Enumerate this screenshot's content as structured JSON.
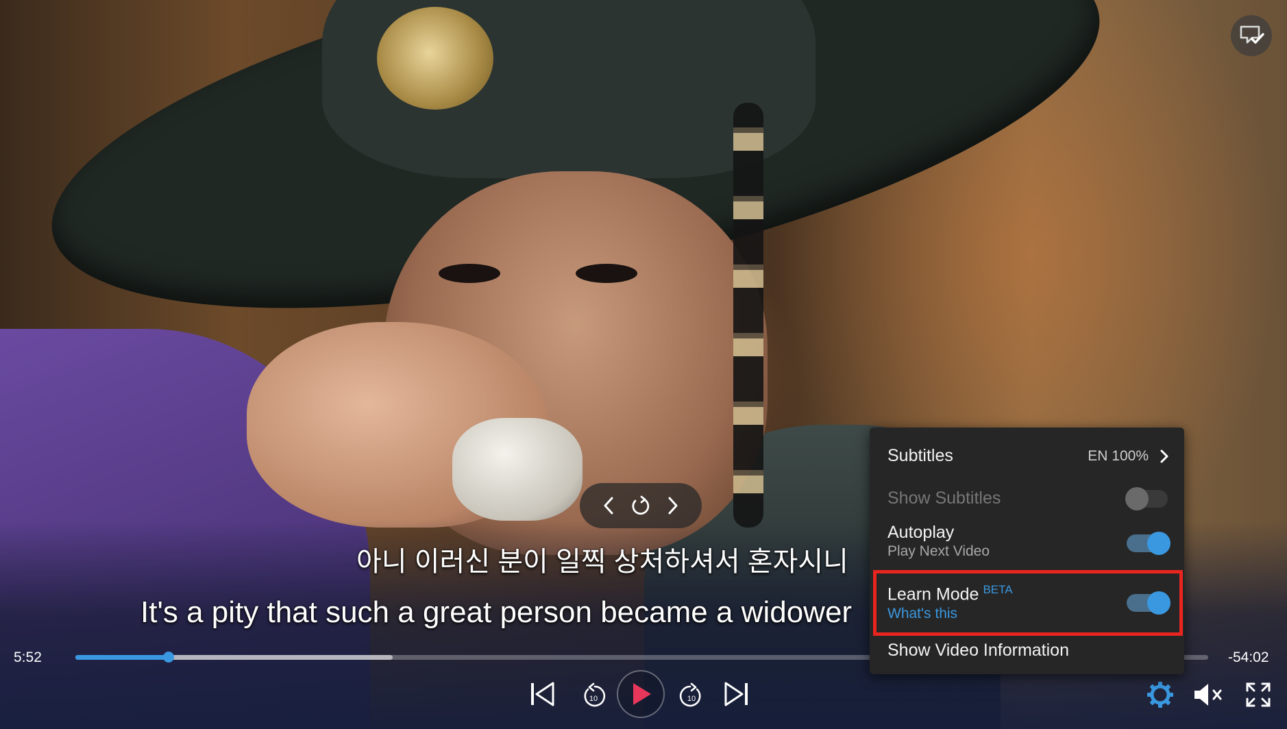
{
  "subtitles": {
    "korean": "아니 이러신 분이 일찍 상처하셔서 혼자시니",
    "english": "It's a pity that such a great person became a widower"
  },
  "subtitle_nav": {
    "prev_icon": "chevron-left-icon",
    "repeat_icon": "repeat-icon",
    "next_icon": "chevron-right-icon"
  },
  "progress": {
    "current_time": "5:52",
    "remaining_time": "-54:02",
    "played_fraction": 0.082,
    "buffered_fraction": 0.28
  },
  "controls": {
    "skip_back_icon": "skip-previous-icon",
    "rewind_icon": "rewind-10-icon",
    "rewind_label": "10",
    "play_icon": "play-icon",
    "forward_icon": "forward-10-icon",
    "forward_label": "10",
    "skip_next_icon": "skip-next-icon",
    "settings_icon": "gear-icon",
    "mute_icon": "volume-muted-icon",
    "fullscreen_icon": "fullscreen-icon"
  },
  "settings_menu": {
    "subtitles": {
      "label": "Subtitles",
      "value": "EN 100%"
    },
    "show_subtitles": {
      "label": "Show Subtitles",
      "enabled": false
    },
    "autoplay": {
      "label": "Autoplay",
      "sublabel": "Play Next Video",
      "enabled": true
    },
    "learn_mode": {
      "label": "Learn Mode",
      "badge": "BETA",
      "link": "What's this",
      "enabled": true
    },
    "video_info": {
      "label": "Show Video Information"
    }
  },
  "colors": {
    "accent": "#3a98e0",
    "play": "#e8375a",
    "highlight": "#e8251f",
    "menu_bg": "#262626"
  }
}
